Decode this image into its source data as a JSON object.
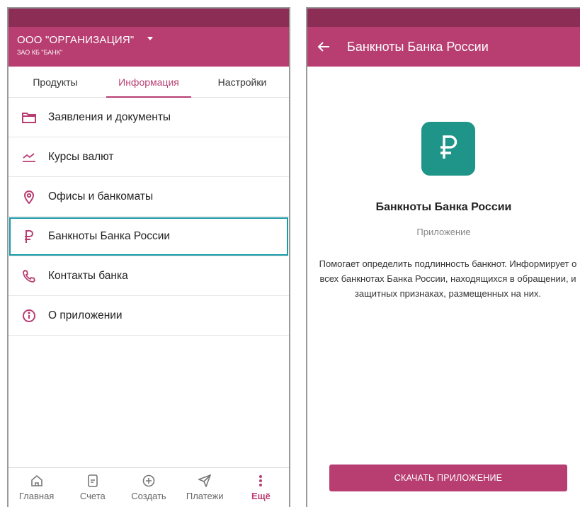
{
  "colors": {
    "primary": "#b83e72",
    "statusbar": "#8c2d55",
    "highlight": "#1a9aa8",
    "logo": "#1f9488"
  },
  "left": {
    "header": {
      "org_name": "ООО \"ОРГАНИЗАЦИЯ\"",
      "bank_name": "ЗАО КБ \"БАНК\"",
      "dropdown_icon": "caret-down-icon"
    },
    "tabs": [
      {
        "label": "Продукты",
        "active": false
      },
      {
        "label": "Информация",
        "active": true
      },
      {
        "label": "Настройки",
        "active": false
      }
    ],
    "menu": [
      {
        "label": "Заявления и документы",
        "icon": "folder-icon"
      },
      {
        "label": "Курсы валют",
        "icon": "chart-icon"
      },
      {
        "label": "Офисы и банкоматы",
        "icon": "location-pin-icon"
      },
      {
        "label": "Банкноты Банка России",
        "icon": "ruble-icon",
        "highlighted": true
      },
      {
        "label": "Контакты банка",
        "icon": "phone-icon"
      },
      {
        "label": "О приложении",
        "icon": "info-icon"
      }
    ],
    "bottom_nav": [
      {
        "label": "Главная",
        "icon": "home-icon"
      },
      {
        "label": "Счета",
        "icon": "document-icon"
      },
      {
        "label": "Создать",
        "icon": "plus-circle-icon"
      },
      {
        "label": "Платежи",
        "icon": "send-icon"
      },
      {
        "label": "Ещё",
        "icon": "more-vertical-icon",
        "active": true
      }
    ]
  },
  "right": {
    "header": {
      "title": "Банкноты Банка России",
      "back_icon": "arrow-left-icon"
    },
    "app": {
      "logo_icon": "ruble-icon",
      "title": "Банкноты Банка России",
      "subtitle": "Приложение",
      "description": "Помогает определить подлинность банкнот. Информирует о всех банкнотах Банка России, находящихся в обращении, и защитных признаках, размещенных на них.",
      "button_label": "СКАЧАТЬ ПРИЛОЖЕНИЕ"
    }
  }
}
